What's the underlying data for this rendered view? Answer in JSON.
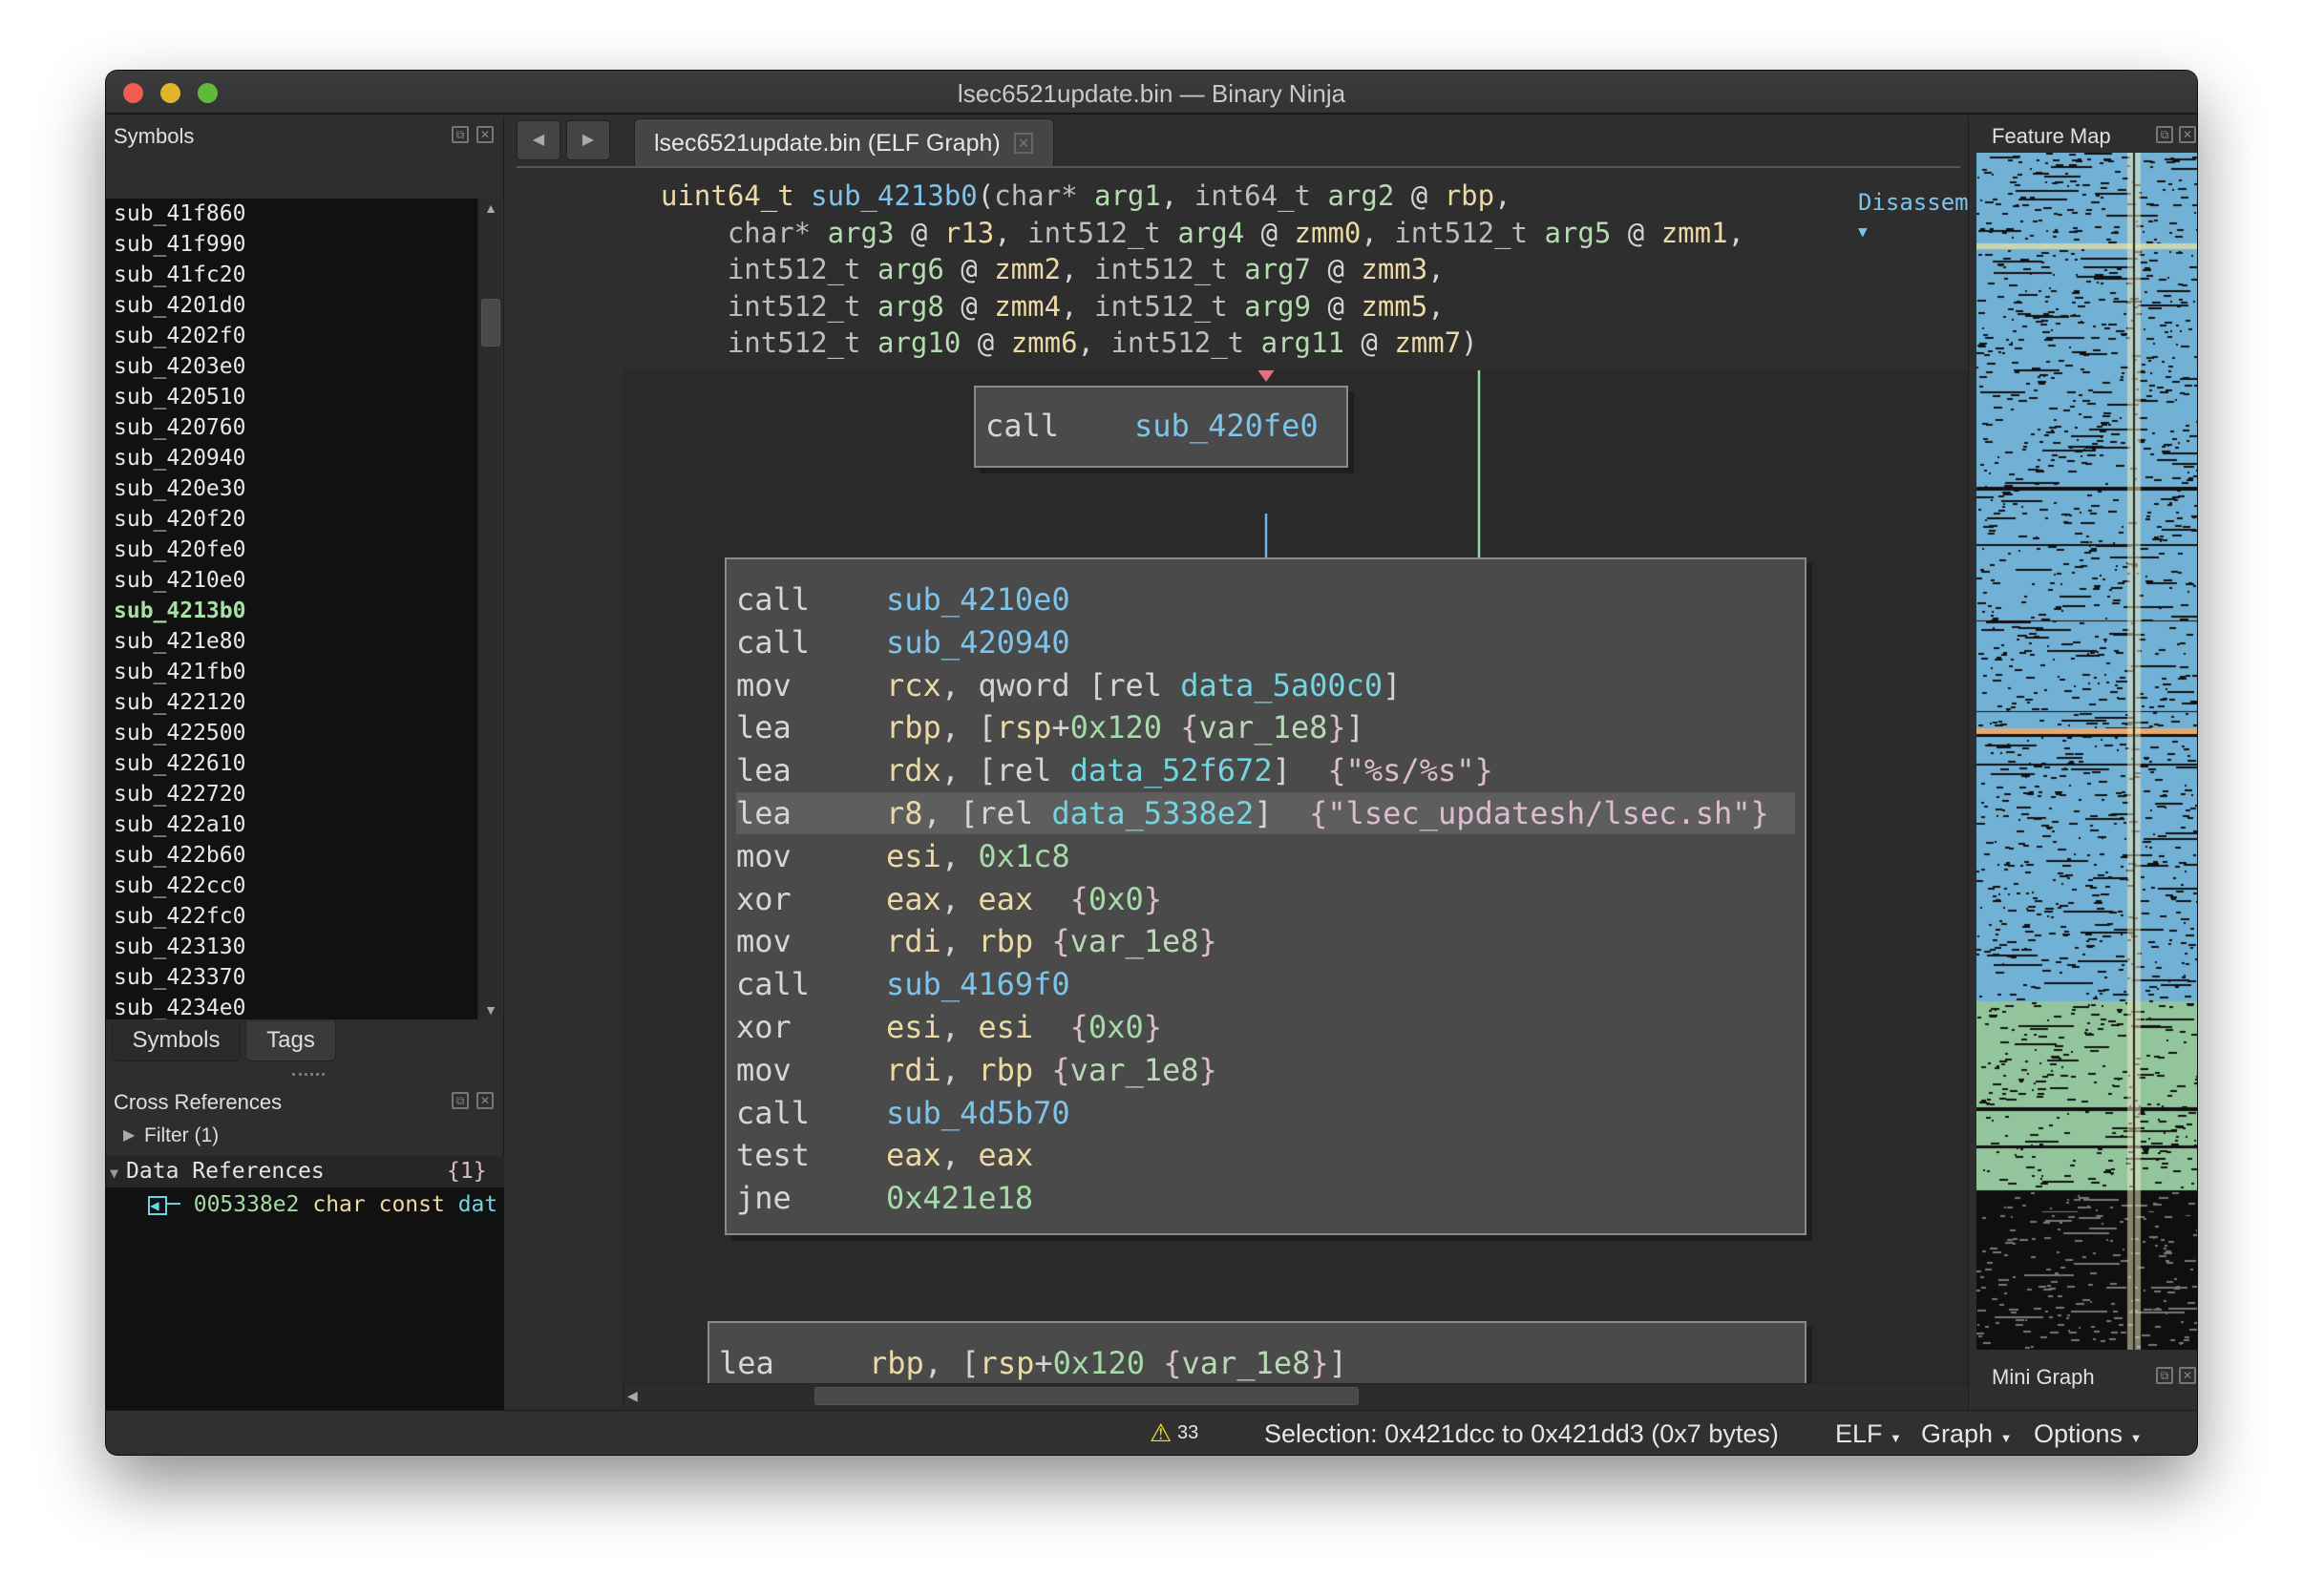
{
  "window": {
    "title": "lsec6521update.bin — Binary Ninja"
  },
  "symbols_panel": {
    "title": "Symbols",
    "selected": "sub_4213b0",
    "items": [
      "sub_41f860",
      "sub_41f990",
      "sub_41fc20",
      "sub_4201d0",
      "sub_4202f0",
      "sub_4203e0",
      "sub_420510",
      "sub_420760",
      "sub_420940",
      "sub_420e30",
      "sub_420f20",
      "sub_420fe0",
      "sub_4210e0",
      "sub_4213b0",
      "sub_421e80",
      "sub_421fb0",
      "sub_422120",
      "sub_422500",
      "sub_422610",
      "sub_422720",
      "sub_422a10",
      "sub_422b60",
      "sub_422cc0",
      "sub_422fc0",
      "sub_423130",
      "sub_423370",
      "sub_4234e0"
    ],
    "tabs": [
      "Symbols",
      "Tags"
    ]
  },
  "xrefs": {
    "title": "Cross References",
    "filter": "Filter (1)",
    "group_label": "Data References",
    "group_count": "{1}",
    "item_addr": "005338e2",
    "item_type": "char const",
    "item_name": "dat"
  },
  "tab": {
    "label": "lsec6521update.bin (ELF Graph)"
  },
  "view_mode": "Disassembly",
  "signature": [
    [
      [
        "uint64_t",
        "ret"
      ],
      [
        " ",
        "pun"
      ],
      [
        "sub_4213b0",
        "sym"
      ],
      [
        "(",
        "pun"
      ],
      [
        "char*",
        "type"
      ],
      [
        " ",
        "pun"
      ],
      [
        "arg1",
        "arg"
      ],
      [
        ", ",
        "pun"
      ],
      [
        "int64_t",
        "type"
      ],
      [
        " ",
        "pun"
      ],
      [
        "arg2",
        "arg"
      ],
      [
        " @ ",
        "pun"
      ],
      [
        "rbp",
        "reg"
      ],
      [
        ",",
        "pun"
      ]
    ],
    [
      [
        "    char*",
        "type"
      ],
      [
        " ",
        "pun"
      ],
      [
        "arg3",
        "arg"
      ],
      [
        " @ ",
        "pun"
      ],
      [
        "r13",
        "reg"
      ],
      [
        ", ",
        "pun"
      ],
      [
        "int512_t",
        "type"
      ],
      [
        " ",
        "pun"
      ],
      [
        "arg4",
        "arg"
      ],
      [
        " @ ",
        "pun"
      ],
      [
        "zmm0",
        "reg"
      ],
      [
        ", ",
        "pun"
      ],
      [
        "int512_t",
        "type"
      ],
      [
        " ",
        "pun"
      ],
      [
        "arg5",
        "arg"
      ],
      [
        " @ ",
        "pun"
      ],
      [
        "zmm1",
        "reg"
      ],
      [
        ",",
        "pun"
      ]
    ],
    [
      [
        "    int512_t",
        "type"
      ],
      [
        " ",
        "pun"
      ],
      [
        "arg6",
        "arg"
      ],
      [
        " @ ",
        "pun"
      ],
      [
        "zmm2",
        "reg"
      ],
      [
        ", ",
        "pun"
      ],
      [
        "int512_t",
        "type"
      ],
      [
        " ",
        "pun"
      ],
      [
        "arg7",
        "arg"
      ],
      [
        " @ ",
        "pun"
      ],
      [
        "zmm3",
        "reg"
      ],
      [
        ",",
        "pun"
      ]
    ],
    [
      [
        "    int512_t",
        "type"
      ],
      [
        " ",
        "pun"
      ],
      [
        "arg8",
        "arg"
      ],
      [
        " @ ",
        "pun"
      ],
      [
        "zmm4",
        "reg"
      ],
      [
        ", ",
        "pun"
      ],
      [
        "int512_t",
        "type"
      ],
      [
        " ",
        "pun"
      ],
      [
        "arg9",
        "arg"
      ],
      [
        " @ ",
        "pun"
      ],
      [
        "zmm5",
        "reg"
      ],
      [
        ",",
        "pun"
      ]
    ],
    [
      [
        "    int512_t",
        "type"
      ],
      [
        " ",
        "pun"
      ],
      [
        "arg10",
        "arg"
      ],
      [
        " @ ",
        "pun"
      ],
      [
        "zmm6",
        "reg"
      ],
      [
        ", ",
        "pun"
      ],
      [
        "int512_t",
        "type"
      ],
      [
        " ",
        "pun"
      ],
      [
        "arg11",
        "arg"
      ],
      [
        " @ ",
        "pun"
      ],
      [
        "zmm7",
        "reg"
      ],
      [
        ")",
        "pun"
      ]
    ]
  ],
  "blocks": [
    {
      "lines": [
        {
          "mn": "call",
          "ops": [
            [
              "sub_420fe0",
              "sym"
            ]
          ]
        }
      ]
    },
    {
      "highlight": 5,
      "lines": [
        {
          "mn": "call",
          "ops": [
            [
              "sub_4210e0",
              "sym"
            ]
          ]
        },
        {
          "mn": "call",
          "ops": [
            [
              "sub_420940",
              "sym"
            ]
          ]
        },
        {
          "mn": "mov",
          "ops": [
            [
              "rcx",
              "reg"
            ],
            [
              ", qword [rel ",
              "pun"
            ],
            [
              "data_5a00c0",
              "data"
            ],
            [
              "]",
              "pun"
            ]
          ]
        },
        {
          "mn": "lea",
          "ops": [
            [
              "rbp",
              "reg"
            ],
            [
              ", [",
              "pun"
            ],
            [
              "rsp",
              "reg"
            ],
            [
              "+",
              "pun"
            ],
            [
              "0x120",
              "num"
            ],
            [
              " {",
              "cmt"
            ],
            [
              "var_1e8",
              "var"
            ],
            [
              "}",
              "cmt"
            ],
            [
              "]",
              "pun"
            ]
          ]
        },
        {
          "mn": "lea",
          "ops": [
            [
              "rdx",
              "reg"
            ],
            [
              ", [rel ",
              "pun"
            ],
            [
              "data_52f672",
              "data"
            ],
            [
              "]  ",
              "pun"
            ],
            [
              "{\"%s/%s\"}",
              "cmt"
            ]
          ]
        },
        {
          "mn": "lea",
          "ops": [
            [
              "r8",
              "reg"
            ],
            [
              ", [rel ",
              "pun"
            ],
            [
              "data_5338e2",
              "data"
            ],
            [
              "]  ",
              "pun"
            ],
            [
              "{\"lsec_updatesh/lsec.sh\"}",
              "cmt"
            ]
          ]
        },
        {
          "mn": "mov",
          "ops": [
            [
              "esi",
              "reg"
            ],
            [
              ", ",
              "pun"
            ],
            [
              "0x1c8",
              "num"
            ]
          ]
        },
        {
          "mn": "xor",
          "ops": [
            [
              "eax",
              "reg"
            ],
            [
              ", ",
              "pun"
            ],
            [
              "eax",
              "reg"
            ],
            [
              "  {",
              "cmt"
            ],
            [
              "0x0",
              "num"
            ],
            [
              "}",
              "cmt"
            ]
          ]
        },
        {
          "mn": "mov",
          "ops": [
            [
              "rdi",
              "reg"
            ],
            [
              ", ",
              "pun"
            ],
            [
              "rbp",
              "reg"
            ],
            [
              " {",
              "cmt"
            ],
            [
              "var_1e8",
              "var"
            ],
            [
              "}",
              "cmt"
            ]
          ]
        },
        {
          "mn": "call",
          "ops": [
            [
              "sub_4169f0",
              "sym"
            ]
          ]
        },
        {
          "mn": "xor",
          "ops": [
            [
              "esi",
              "reg"
            ],
            [
              ", ",
              "pun"
            ],
            [
              "esi",
              "reg"
            ],
            [
              "  {",
              "cmt"
            ],
            [
              "0x0",
              "num"
            ],
            [
              "}",
              "cmt"
            ]
          ]
        },
        {
          "mn": "mov",
          "ops": [
            [
              "rdi",
              "reg"
            ],
            [
              ", ",
              "pun"
            ],
            [
              "rbp",
              "reg"
            ],
            [
              " {",
              "cmt"
            ],
            [
              "var_1e8",
              "var"
            ],
            [
              "}",
              "cmt"
            ]
          ]
        },
        {
          "mn": "call",
          "ops": [
            [
              "sub_4d5b70",
              "sym"
            ]
          ]
        },
        {
          "mn": "test",
          "ops": [
            [
              "eax",
              "reg"
            ],
            [
              ", ",
              "pun"
            ],
            [
              "eax",
              "reg"
            ]
          ]
        },
        {
          "mn": "jne",
          "ops": [
            [
              "0x421e18",
              "num"
            ]
          ]
        }
      ]
    },
    {
      "lines": [
        {
          "mn": "lea",
          "ops": [
            [
              "rbp",
              "reg"
            ],
            [
              ", [",
              "pun"
            ],
            [
              "rsp",
              "reg"
            ],
            [
              "+",
              "pun"
            ],
            [
              "0x120",
              "num"
            ],
            [
              " {",
              "cmt"
            ],
            [
              "var_1e8",
              "var"
            ],
            [
              "}",
              "cmt"
            ],
            [
              "]",
              "pun"
            ]
          ]
        }
      ]
    }
  ],
  "feature_map": {
    "title": "Feature Map"
  },
  "mini_graph": {
    "title": "Mini Graph"
  },
  "status": {
    "warning_count": "33",
    "selection": "Selection: 0x421dcc to 0x421dd3 (0x7 bytes)",
    "menus": [
      "ELF",
      "Graph",
      "Options"
    ]
  },
  "colors": {
    "edge_true": "#8fd9a8",
    "edge_false": "#e0727f",
    "edge_uncond": "#6cb6e6",
    "accent": "#7ec4ea"
  }
}
